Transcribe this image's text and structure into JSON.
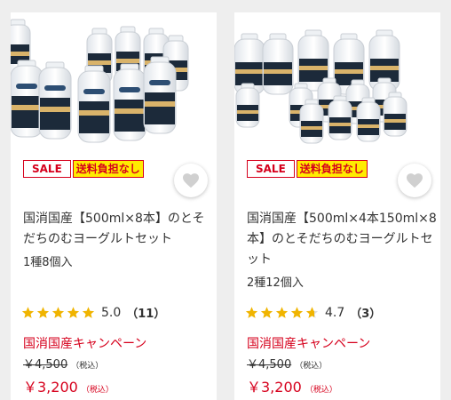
{
  "products": [
    {
      "badges": {
        "sale": "SALE",
        "shipping": "送料負担なし"
      },
      "name": "国消国産【500ml×8本】のとそだちのむヨーグルトセット",
      "count": "1種8個入",
      "rating": {
        "value": 5.0,
        "score": "5.0",
        "reviews": "（11）"
      },
      "campaign": "国消国産キャンペーン",
      "original_price": "￥4,500",
      "original_tax": "（税込）",
      "price": "￥3,200",
      "price_tax": "（税込）"
    },
    {
      "badges": {
        "sale": "SALE",
        "shipping": "送料負担なし"
      },
      "name": "国消国産【500ml×4本150ml×8本】のとそだちのむヨーグルトセット",
      "count": "2種12個入",
      "rating": {
        "value": 4.7,
        "score": "4.7",
        "reviews": "（3）"
      },
      "campaign": "国消国産キャンペーン",
      "original_price": "￥4,500",
      "original_tax": "（税込）",
      "price": "￥3,200",
      "price_tax": "（税込）"
    }
  ],
  "colors": {
    "accent": "#d6001c",
    "shipping_bg": "#ffec00",
    "star": "#f0b400",
    "star_empty": "#dddddd"
  },
  "icons": {
    "favorite": "heart-icon",
    "rating": "star-icon"
  }
}
